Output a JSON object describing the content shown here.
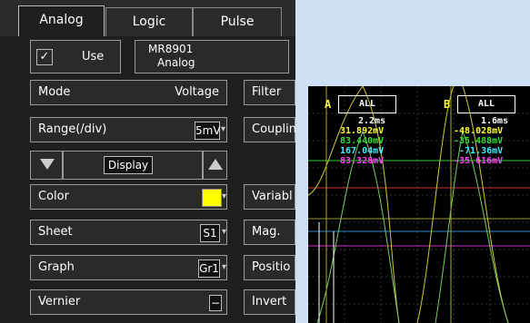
{
  "tabs": [
    {
      "label": "Analog"
    },
    {
      "label": "Logic"
    },
    {
      "label": "Pulse"
    }
  ],
  "use_label": "Use",
  "module": {
    "line1": "MR8901",
    "line2": "Analog"
  },
  "rows": {
    "mode": {
      "label": "Mode",
      "value": "Voltage"
    },
    "range": {
      "label": "Range(/div)",
      "value": "5mV"
    },
    "display": {
      "label": "Display"
    },
    "color": {
      "label": "Color",
      "swatch": "#ffff00"
    },
    "sheet": {
      "label": "Sheet",
      "value": "S1"
    },
    "graph": {
      "label": "Graph",
      "value": "Gr1"
    },
    "vernier": {
      "label": "Vernier",
      "value": "−"
    }
  },
  "right_labels": {
    "filter": "Filter",
    "coupling": "Couplin",
    "variable": "Variabl",
    "mag": "Mag.",
    "position": "Positio",
    "invert": "Invert"
  },
  "scope": {
    "cursor_a": {
      "letter": "A",
      "label": "ALL",
      "values": [
        "2.2ms",
        "31.892mV",
        "83.440mV",
        "167.04mV",
        "83.328mV"
      ]
    },
    "cursor_b": {
      "letter": "B",
      "label": "ALL",
      "values": [
        "1.6ms",
        "-48.028mV",
        "-35.488mV",
        "-71.36mV",
        "-35.616mV"
      ]
    },
    "colors": {
      "yellow": "#ffff33",
      "green": "#33dd33",
      "cyan": "#44eeff",
      "magenta": "#ff44ff",
      "white": "#ffffff"
    }
  }
}
